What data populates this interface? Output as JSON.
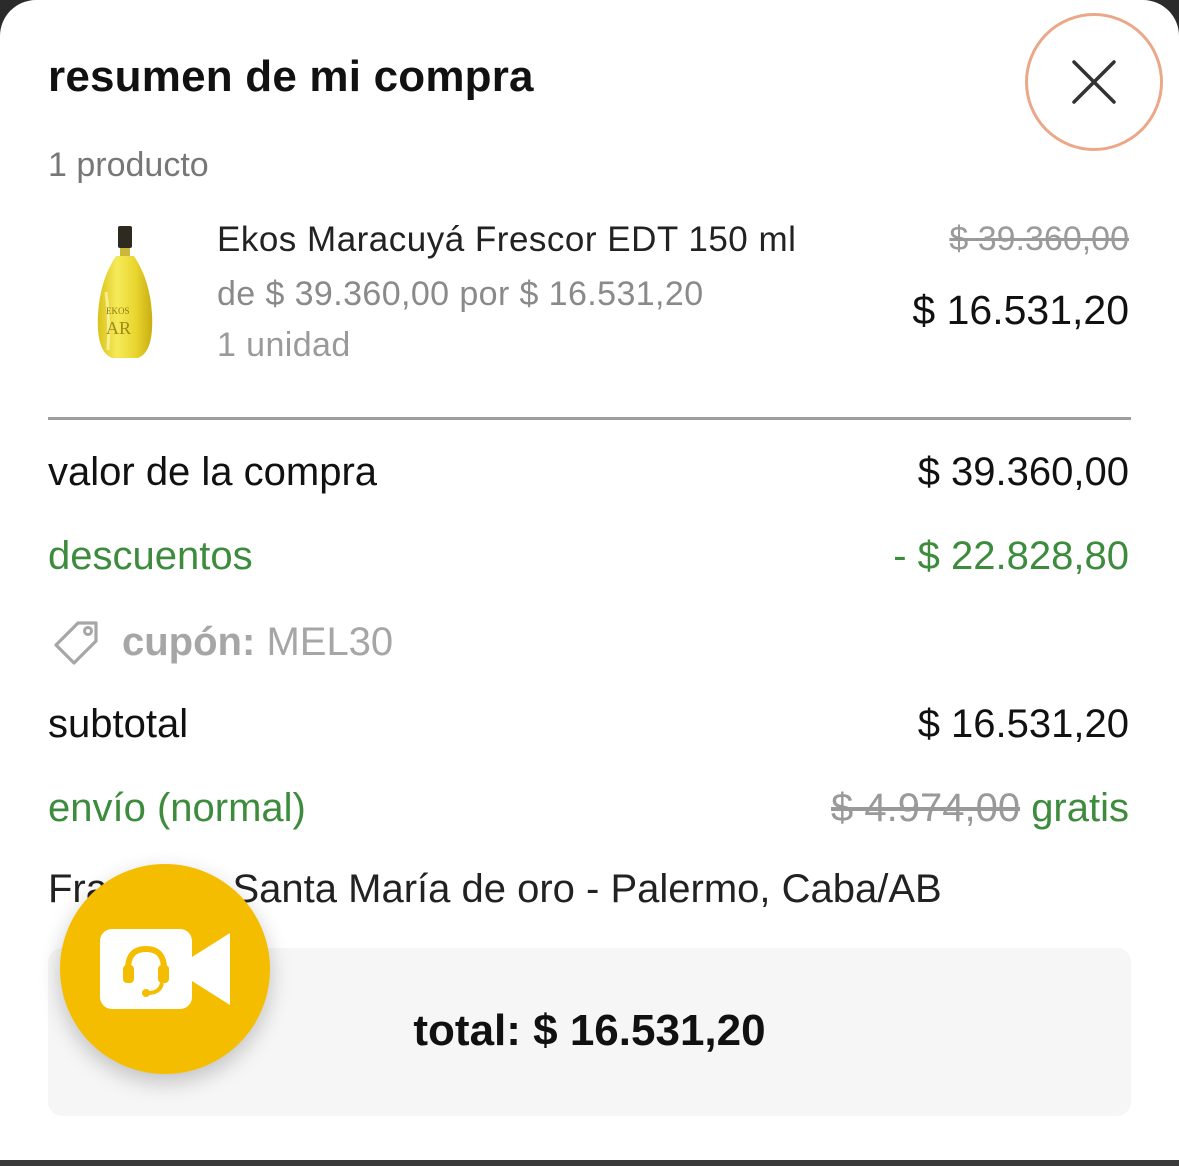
{
  "header": {
    "title": "resumen de mi compra",
    "close_icon": "close-icon",
    "close_ring_color": "#eba889"
  },
  "cart": {
    "count_label": "1 producto"
  },
  "product": {
    "image_icon": "perfume-bottle-image",
    "name": "Ekos Maracuyá Frescor EDT 150 ml",
    "price_line": "de $ 39.360,00 por $ 16.531,20",
    "quantity": "1 unidad",
    "original_price": "$ 39.360,00",
    "final_price": "$ 16.531,20"
  },
  "summary": {
    "purchase_label": "valor de la compra",
    "purchase_value": "$ 39.360,00",
    "discounts_label": "descuentos",
    "discounts_value": "- $ 22.828,80",
    "coupon_icon": "tag-icon",
    "coupon_label": "cupón:",
    "coupon_code": "MEL30",
    "subtotal_label": "subtotal",
    "subtotal_value": "$ 16.531,20",
    "shipping_label": "envío (normal)",
    "shipping_original": "$ 4.974,00",
    "shipping_value": "gratis",
    "address": "Francisco Santa María de oro - Palermo, Caba/AB"
  },
  "total": {
    "label": "total: $ 16.531,20"
  },
  "fab": {
    "icon": "video-support-icon",
    "color": "#f5bd00"
  },
  "colors": {
    "discount_green": "#3d8b3d"
  }
}
